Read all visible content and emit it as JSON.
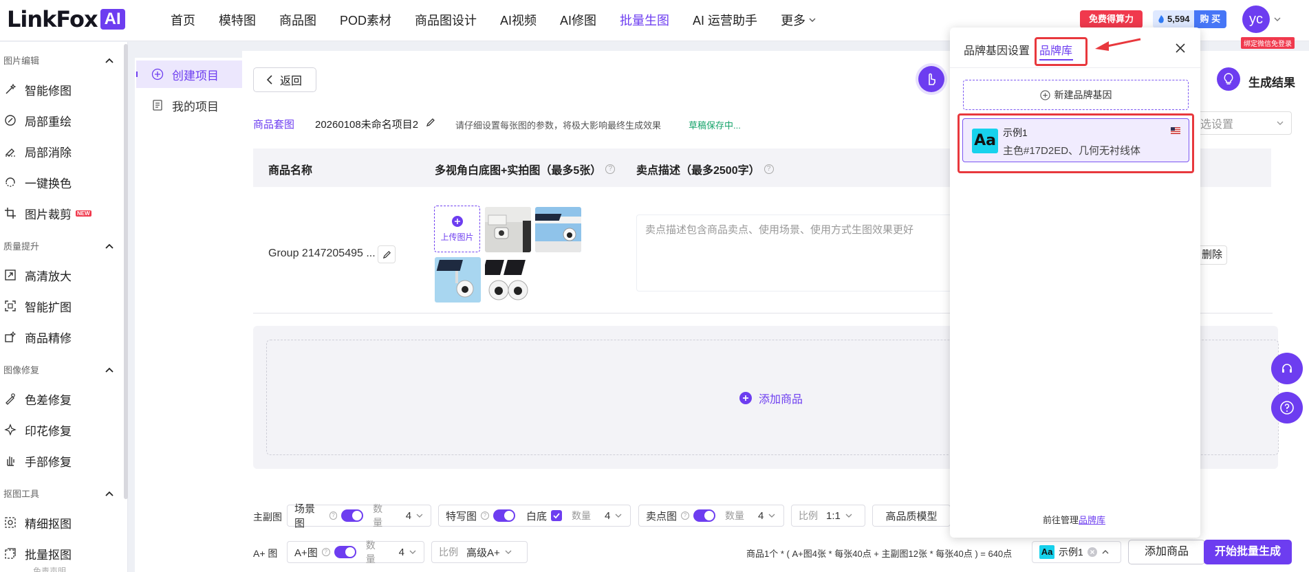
{
  "app": {
    "logo_text": "LinkFox",
    "logo_badge": "AI"
  },
  "nav": {
    "items": [
      {
        "label": "首页"
      },
      {
        "label": "模特图"
      },
      {
        "label": "商品图"
      },
      {
        "label": "POD素材"
      },
      {
        "label": "商品图设计"
      },
      {
        "label": "AI视频"
      },
      {
        "label": "AI修图"
      },
      {
        "label": "批量生图",
        "active": true
      },
      {
        "label": "AI 运营助手"
      }
    ],
    "more_label": "更多"
  },
  "header_right": {
    "free_label": "免费得算力",
    "credits": "5,594",
    "buy_label": "购 买",
    "avatar_text": "yc",
    "bind_badge": "绑定微信免登录"
  },
  "sidebar": {
    "sections": [
      {
        "title": "图片编辑",
        "items": [
          "智能修图",
          "局部重绘",
          "局部消除",
          "一键换色",
          "图片裁剪"
        ]
      },
      {
        "title": "质量提升",
        "items": [
          "高清放大",
          "智能扩图",
          "商品精修"
        ]
      },
      {
        "title": "图像修复",
        "items": [
          "色差修复",
          "印花修复",
          "手部修复"
        ]
      },
      {
        "title": "抠图工具",
        "items": [
          "精细抠图",
          "批量抠图"
        ]
      }
    ],
    "new_badge": "NEW",
    "cutoff_item": "免责声明"
  },
  "subnav": {
    "create_label": "创建项目",
    "my_label": "我的项目"
  },
  "main": {
    "back_label": "返回",
    "result_title": "生成结果",
    "crumb_link": "商品套图",
    "project_name": "20260108未命名项目2",
    "hint": "请仔细设置每张图的参数，将极大影响最终生成效果",
    "saving": "草稿保存中...",
    "right_select_placeholder": "选设置",
    "columns": {
      "name": "商品名称",
      "images": "多视角白底图+实拍图（最多5张）",
      "desc": "卖点描述（最多2500字）"
    },
    "product": {
      "name": "Group 2147205495 ...",
      "upload_label": "上传图片",
      "desc_placeholder": "卖点描述包含商品卖点、使用场景、使用方式生图效果更好",
      "delete_label": "删除"
    },
    "add_product_label": "添加商品"
  },
  "options": {
    "main_row_label": "主副图",
    "aplus_row_label": "A+ 图",
    "scene": {
      "label": "场景图",
      "qty_label": "数量",
      "qty": "4"
    },
    "closeup": {
      "label": "特写图",
      "white_label": "白底",
      "qty_label": "数量",
      "qty": "4"
    },
    "selling": {
      "label": "卖点图",
      "qty_label": "数量",
      "qty": "4"
    },
    "ratio": {
      "label": "比例",
      "value": "1:1"
    },
    "model_label": "高品质模型",
    "aplus": {
      "label": "A+图",
      "qty_label": "数量",
      "qty": "4"
    },
    "aplus_ratio": {
      "label": "比例",
      "value": "高级A+"
    },
    "formula": "商品1个 * ( A+图4张 * 每张40点 + 主副图12张 * 每张40点 ) = 640点",
    "style_name": "示例1",
    "add_product_btn": "添加商品",
    "start_btn": "开始批量生成"
  },
  "panel": {
    "tab_settings": "品牌基因设置",
    "tab_library": "品牌库",
    "new_gene_label": "新建品牌基因",
    "brand": {
      "logo_text": "Aa",
      "name": "示例1",
      "desc": "主色#17D2ED、几何无衬线体",
      "color": "#17D2ED"
    },
    "manage_prefix": "前往管理",
    "manage_link": "品牌库"
  },
  "colors": {
    "accent": "#6D3DF0",
    "highlight_red": "#E8383D",
    "brand_swatch": "#17D2ED"
  }
}
